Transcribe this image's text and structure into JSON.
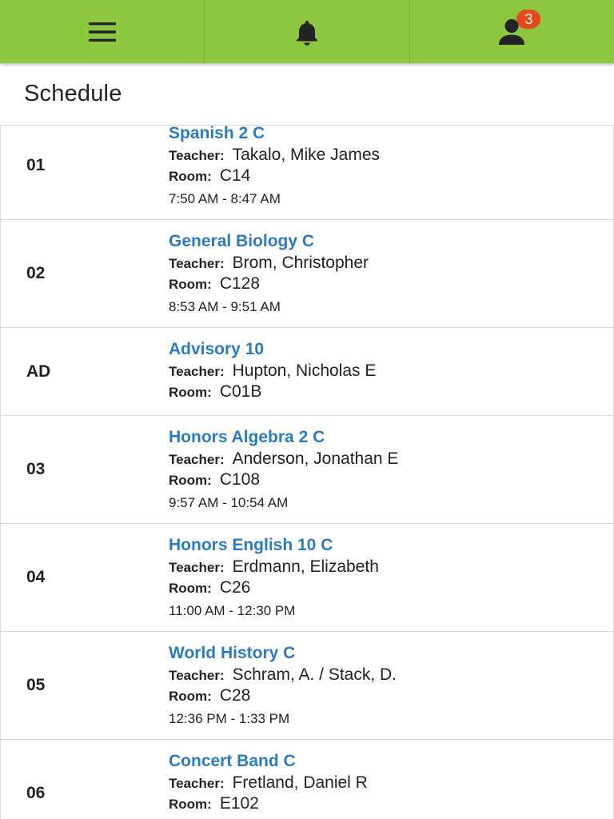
{
  "topbar": {
    "menu_icon": "hamburger-menu-icon",
    "notifications_icon": "bell-icon",
    "notifications_count": "3",
    "profile_icon": "user-icon",
    "accent_color": "#8dc63f",
    "badge_color": "#e24a1e"
  },
  "page": {
    "title": "Schedule"
  },
  "labels": {
    "teacher": "Teacher:",
    "room": "Room:"
  },
  "schedule": [
    {
      "period": "01",
      "course": "Spanish 2 C",
      "teacher": "Takalo, Mike James",
      "room": "C14",
      "time": "7:50 AM - 8:47 AM"
    },
    {
      "period": "02",
      "course": "General Biology C",
      "teacher": "Brom, Christopher",
      "room": "C128",
      "time": "8:53 AM - 9:51 AM"
    },
    {
      "period": "AD",
      "course": "Advisory 10",
      "teacher": "Hupton, Nicholas E",
      "room": "C01B",
      "time": ""
    },
    {
      "period": "03",
      "course": "Honors Algebra 2 C",
      "teacher": "Anderson, Jonathan E",
      "room": "C108",
      "time": "9:57 AM - 10:54 AM"
    },
    {
      "period": "04",
      "course": "Honors English 10 C",
      "teacher": "Erdmann, Elizabeth",
      "room": "C26",
      "time": "11:00 AM - 12:30 PM"
    },
    {
      "period": "05",
      "course": "World History C",
      "teacher": "Schram, A. / Stack, D.",
      "room": "C28",
      "time": "12:36 PM - 1:33 PM"
    },
    {
      "period": "06",
      "course": "Concert Band C",
      "teacher": "Fretland, Daniel R",
      "room": "E102",
      "time": ""
    }
  ],
  "link_color": "#2b7bc1"
}
